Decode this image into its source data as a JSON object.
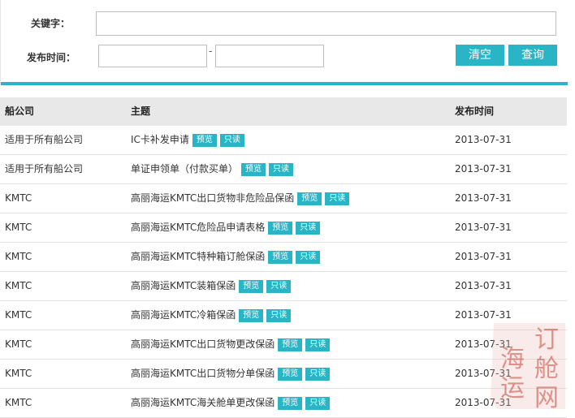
{
  "search": {
    "keyword_label": "关键字：",
    "keyword_value": "",
    "date_label": "发布时间：",
    "date_from": "",
    "date_separator": "-",
    "date_to": "",
    "clear_label": "清空",
    "query_label": "查询"
  },
  "table": {
    "headers": [
      "船公司",
      "主题",
      "发布时间"
    ],
    "preview_label": "预览",
    "readonly_label": "只读",
    "rows": [
      {
        "company": "适用于所有船公司",
        "subject": "IC卡补发申请",
        "date": "2013-07-31"
      },
      {
        "company": "适用于所有船公司",
        "subject": "单证申领单（付款买单）",
        "date": "2013-07-31"
      },
      {
        "company": "KMTC",
        "subject": "高丽海运KMTC出口货物非危险品保函",
        "date": "2013-07-31"
      },
      {
        "company": "KMTC",
        "subject": "高丽海运KMTC危险品申请表格",
        "date": "2013-07-31"
      },
      {
        "company": "KMTC",
        "subject": "高丽海运KMTC特种箱订舱保函",
        "date": "2013-07-31"
      },
      {
        "company": "KMTC",
        "subject": "高丽海运KMTC装箱保函",
        "date": "2013-07-31"
      },
      {
        "company": "KMTC",
        "subject": "高丽海运KMTC冷箱保函",
        "date": "2013-07-31"
      },
      {
        "company": "KMTC",
        "subject": "高丽海运KMTC出口货物更改保函",
        "date": "2013-07-31"
      },
      {
        "company": "KMTC",
        "subject": "高丽海运KMTC出口货物分单保函",
        "date": "2013-07-31"
      },
      {
        "company": "KMTC",
        "subject": "高丽海运KMTC海关舱单更改保函",
        "date": "2013-07-31"
      }
    ]
  },
  "watermark": {
    "text": "订舱海运网",
    "color": "#c0392b"
  },
  "colors": {
    "accent": "#29b5c6",
    "header_bg": "#e8e8e8"
  }
}
